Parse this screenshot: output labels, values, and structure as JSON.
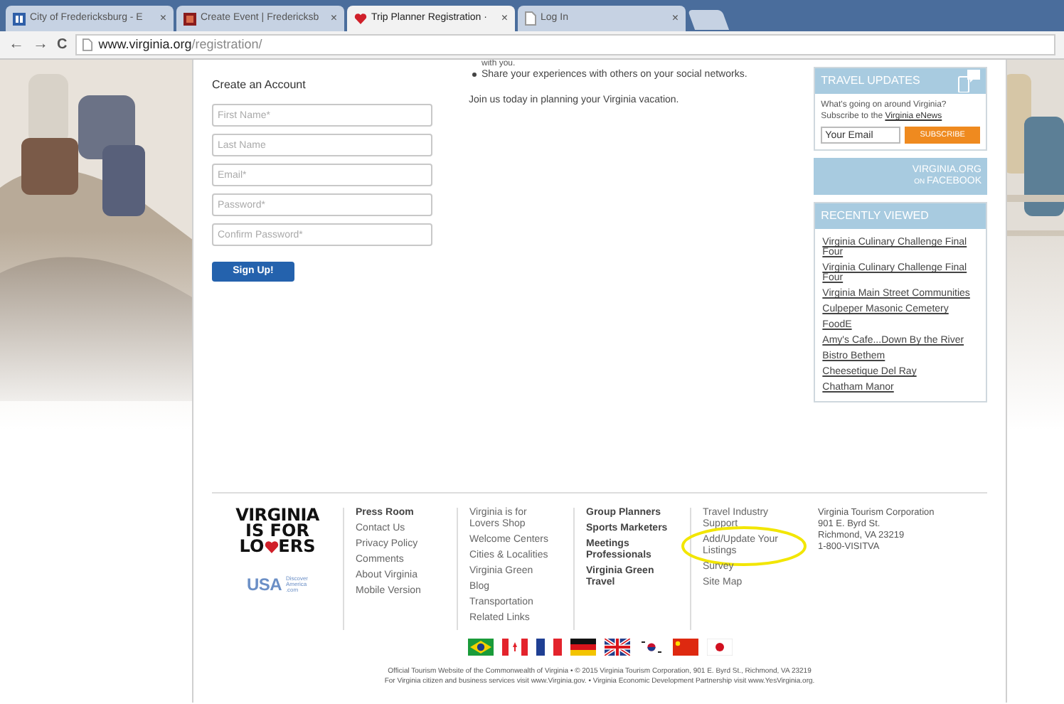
{
  "browser": {
    "tabs": [
      {
        "title": "City of Fredericksburg - E",
        "close": "×",
        "selected": false,
        "kind": "letter"
      },
      {
        "title": "Create Event | Fredericksb",
        "close": "×",
        "selected": false,
        "kind": "square"
      },
      {
        "title": "Trip Planner Registration ·",
        "close": "×",
        "selected": true,
        "kind": "heart"
      },
      {
        "title": "Log In",
        "close": "×",
        "selected": false,
        "kind": "page"
      }
    ],
    "nav": {
      "back": "←",
      "forward": "→",
      "reload": "C"
    },
    "url": {
      "host": "www.virginia.org",
      "path": "/registration/"
    }
  },
  "intro": {
    "cut_line": "with you.",
    "bullet": "Share your experiences with others on your social networks.",
    "closing": "Join us today in planning your Virginia vacation."
  },
  "form": {
    "title": "Create an Account",
    "fields": [
      {
        "placeholder": "First Name*"
      },
      {
        "placeholder": "Last Name"
      },
      {
        "placeholder": "Email*"
      },
      {
        "placeholder": "Password*"
      },
      {
        "placeholder": "Confirm Password*"
      }
    ],
    "submit": "Sign Up!"
  },
  "sidebar": {
    "travel_updates": {
      "title": "TRAVEL UPDATES",
      "text": "What's going on around Virginia? Subscribe to the ",
      "link": "Virginia eNews",
      "email_placeholder": "Your Email",
      "button": "SUBSCRIBE"
    },
    "facebook": {
      "line1": "VIRGINIA.ORG",
      "line2_small": "ON",
      "line2": "FACEBOOK"
    },
    "recently_viewed": {
      "title": "RECENTLY VIEWED",
      "items": [
        "Virginia Culinary Challenge Final Four",
        "Virginia Culinary Challenge Final Four",
        "Virginia Main Street Communities",
        "Culpeper Masonic Cemetery",
        "FoodE",
        "Amy's Cafe...Down By the River",
        "Bistro Bethem",
        "Cheesetique Del Ray",
        "Chatham Manor"
      ]
    }
  },
  "footer": {
    "logo": {
      "line1": "VIRGINIA",
      "line2": "IS FOR",
      "line3_start": "LO",
      "line3_end": "ERS"
    },
    "usa_logo": {
      "text": "USA",
      "tag_lines": [
        "Discover",
        "America",
        ".com"
      ]
    },
    "columns": [
      [
        {
          "text": "Press Room",
          "bold": true
        },
        {
          "text": "Contact Us",
          "bold": false
        },
        {
          "text": "Privacy Policy",
          "bold": false
        },
        {
          "text": "Comments",
          "bold": false
        },
        {
          "text": "About Virginia",
          "bold": false
        },
        {
          "text": "Mobile Version",
          "bold": false
        }
      ],
      [
        {
          "text": "Virginia is for Lovers Shop",
          "bold": false
        },
        {
          "text": "Welcome Centers",
          "bold": false
        },
        {
          "text": "Cities & Localities",
          "bold": false
        },
        {
          "text": "Virginia Green",
          "bold": false
        },
        {
          "text": "Blog",
          "bold": false
        },
        {
          "text": "Transportation",
          "bold": false
        },
        {
          "text": "Related Links",
          "bold": false
        }
      ],
      [
        {
          "text": "Group Planners",
          "bold": true
        },
        {
          "text": "Sports Marketers",
          "bold": true
        },
        {
          "text": "Meetings Professionals",
          "bold": true
        },
        {
          "text": "Virginia Green Travel",
          "bold": true
        }
      ],
      [
        {
          "text": "Travel Industry Support",
          "bold": false
        },
        {
          "text": "Add/Update Your Listings",
          "bold": false,
          "circled": true
        },
        {
          "text": "Survey",
          "bold": false
        },
        {
          "text": "Site Map",
          "bold": false
        }
      ]
    ],
    "address": [
      "Virginia Tourism Corporation",
      "901 E. Byrd St.",
      "Richmond, VA 23219",
      "1-800-VISITVA"
    ],
    "flags": [
      {
        "kind": "brazil"
      },
      {
        "kind": "canada"
      },
      {
        "kind": "france"
      },
      {
        "kind": "germany"
      },
      {
        "kind": "uk"
      },
      {
        "kind": "korea"
      },
      {
        "kind": "china"
      },
      {
        "kind": "japan"
      }
    ],
    "legal": [
      "Official Tourism Website of the Commonwealth of Virginia • © 2015 Virginia Tourism Corporation, 901 E. Byrd St., Richmond, VA 23219",
      "For Virginia citizen and business services visit www.Virginia.gov. • Virginia Economic Development Partnership visit www.YesVirginia.org."
    ]
  }
}
